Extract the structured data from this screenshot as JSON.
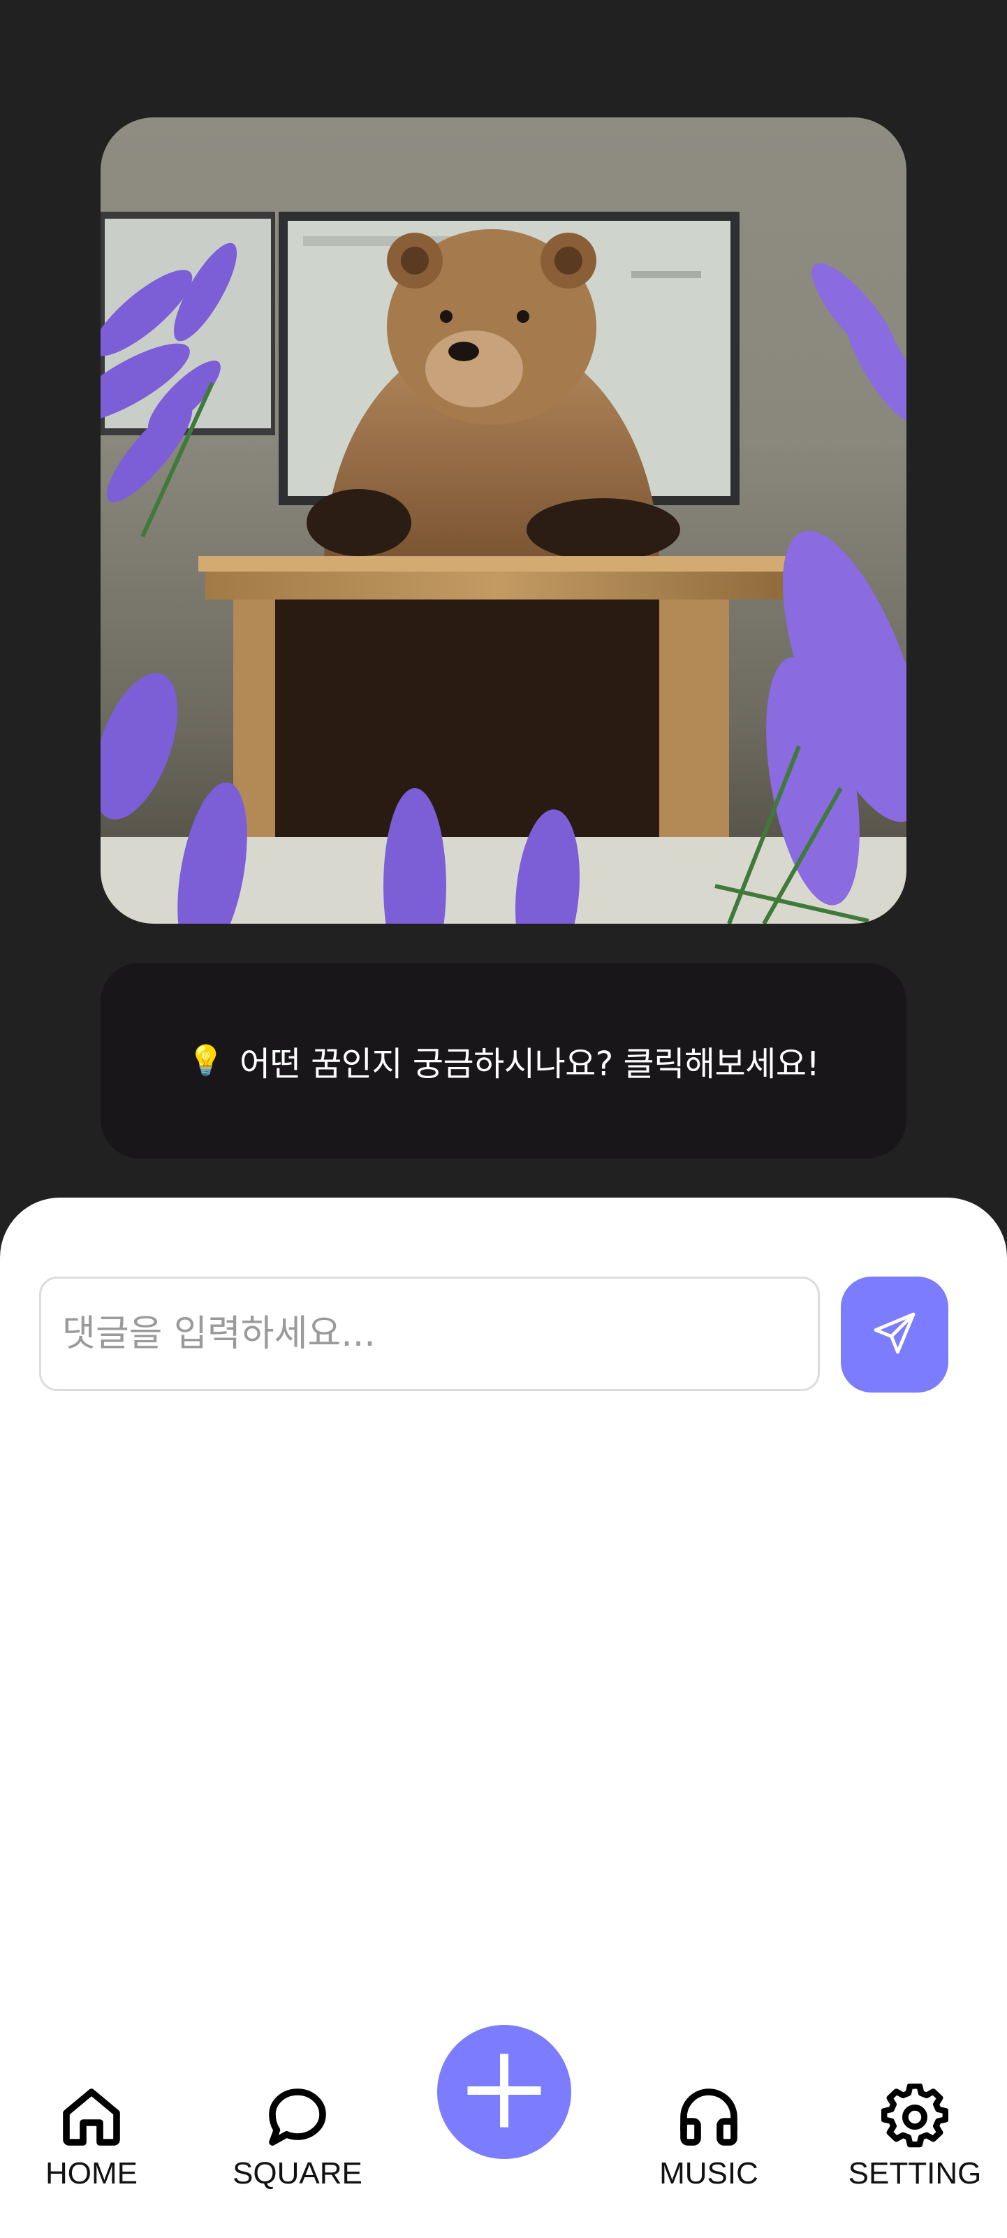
{
  "dream_card": {
    "image_alt_icon": "bear-at-desk-illustration"
  },
  "prompt": {
    "icon": "lightbulb-icon",
    "text": "어떤 꿈인지 궁금하시나요? 클릭해보세요!"
  },
  "comment": {
    "placeholder": "댓글을 입력하세요...",
    "value": "",
    "send_icon": "send-icon"
  },
  "nav": {
    "items": [
      {
        "label": "HOME",
        "icon": "home-icon"
      },
      {
        "label": "SQUARE",
        "icon": "chat-bubble-icon"
      },
      {
        "label": "MUSIC",
        "icon": "headphones-icon"
      },
      {
        "label": "SETTING",
        "icon": "gear-icon"
      }
    ],
    "fab_icon": "plus-icon"
  },
  "colors": {
    "background": "#212121",
    "accent": "#7c7cff",
    "prompt_box": "#181618"
  }
}
